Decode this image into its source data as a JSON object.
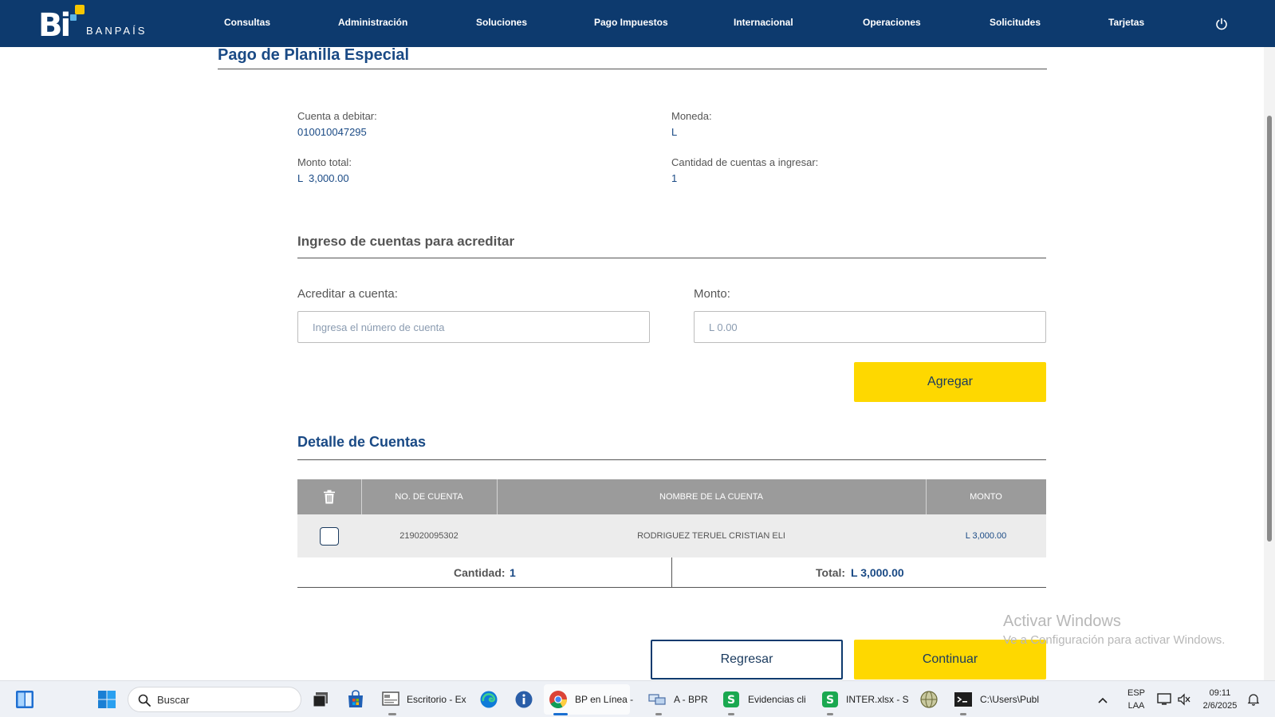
{
  "brand": {
    "logo_mark": "Bi",
    "logo_name": "BANPAÍS"
  },
  "nav": {
    "items": [
      "Consultas",
      "Administración",
      "Soluciones",
      "Pago Impuestos",
      "Internacional",
      "Operaciones",
      "Solicitudes",
      "Tarjetas"
    ],
    "power_icon": "power-icon"
  },
  "page": {
    "title": "Pago de Planilla Especial"
  },
  "summary": {
    "cuenta_label": "Cuenta a debitar:",
    "cuenta_value": "010010047295",
    "moneda_label": "Moneda:",
    "moneda_value": "L",
    "monto_label": "Monto total:",
    "monto_value": "L  3,000.00",
    "cantidad_label": "Cantidad de cuentas a ingresar:",
    "cantidad_value": "1"
  },
  "form": {
    "section_title": "Ingreso de cuentas para acreditar",
    "account_label": "Acreditar a cuenta:",
    "account_placeholder": "Ingresa el número de cuenta",
    "amount_label": "Monto:",
    "amount_placeholder": "L 0.00",
    "add_button": "Agregar"
  },
  "details": {
    "title": "Detalle de Cuentas",
    "columns": [
      "NO. DE CUENTA",
      "NOMBRE DE LA CUENTA",
      "MONTO"
    ],
    "rows": [
      {
        "account": "219020095302",
        "name": "RODRIGUEZ TERUEL CRISTIAN ELI",
        "amount": "L 3,000.00"
      }
    ],
    "count_label": "Cantidad:",
    "count_value": "1",
    "total_label": "Total:",
    "total_value": "L 3,000.00"
  },
  "actions": {
    "back": "Regresar",
    "continue": "Continuar"
  },
  "watermark": {
    "line1": "Activar Windows",
    "line2": "Ve a Configuración para activar Windows."
  },
  "taskbar": {
    "search_placeholder": "Buscar",
    "apps": [
      "Escritorio - Ex",
      "BP en Línea -",
      "A - BPR",
      "Evidencias cli",
      "INTER.xlsx - S",
      "C:\\Users\\Publ"
    ],
    "lang_top": "ESP",
    "lang_bottom": "LAA",
    "time": "09:11",
    "date": "2/6/2025"
  },
  "colors": {
    "navy": "#0d3a6e",
    "yellow": "#fed800",
    "link_blue": "#1a4a85",
    "table_header": "#9b9b9b"
  }
}
